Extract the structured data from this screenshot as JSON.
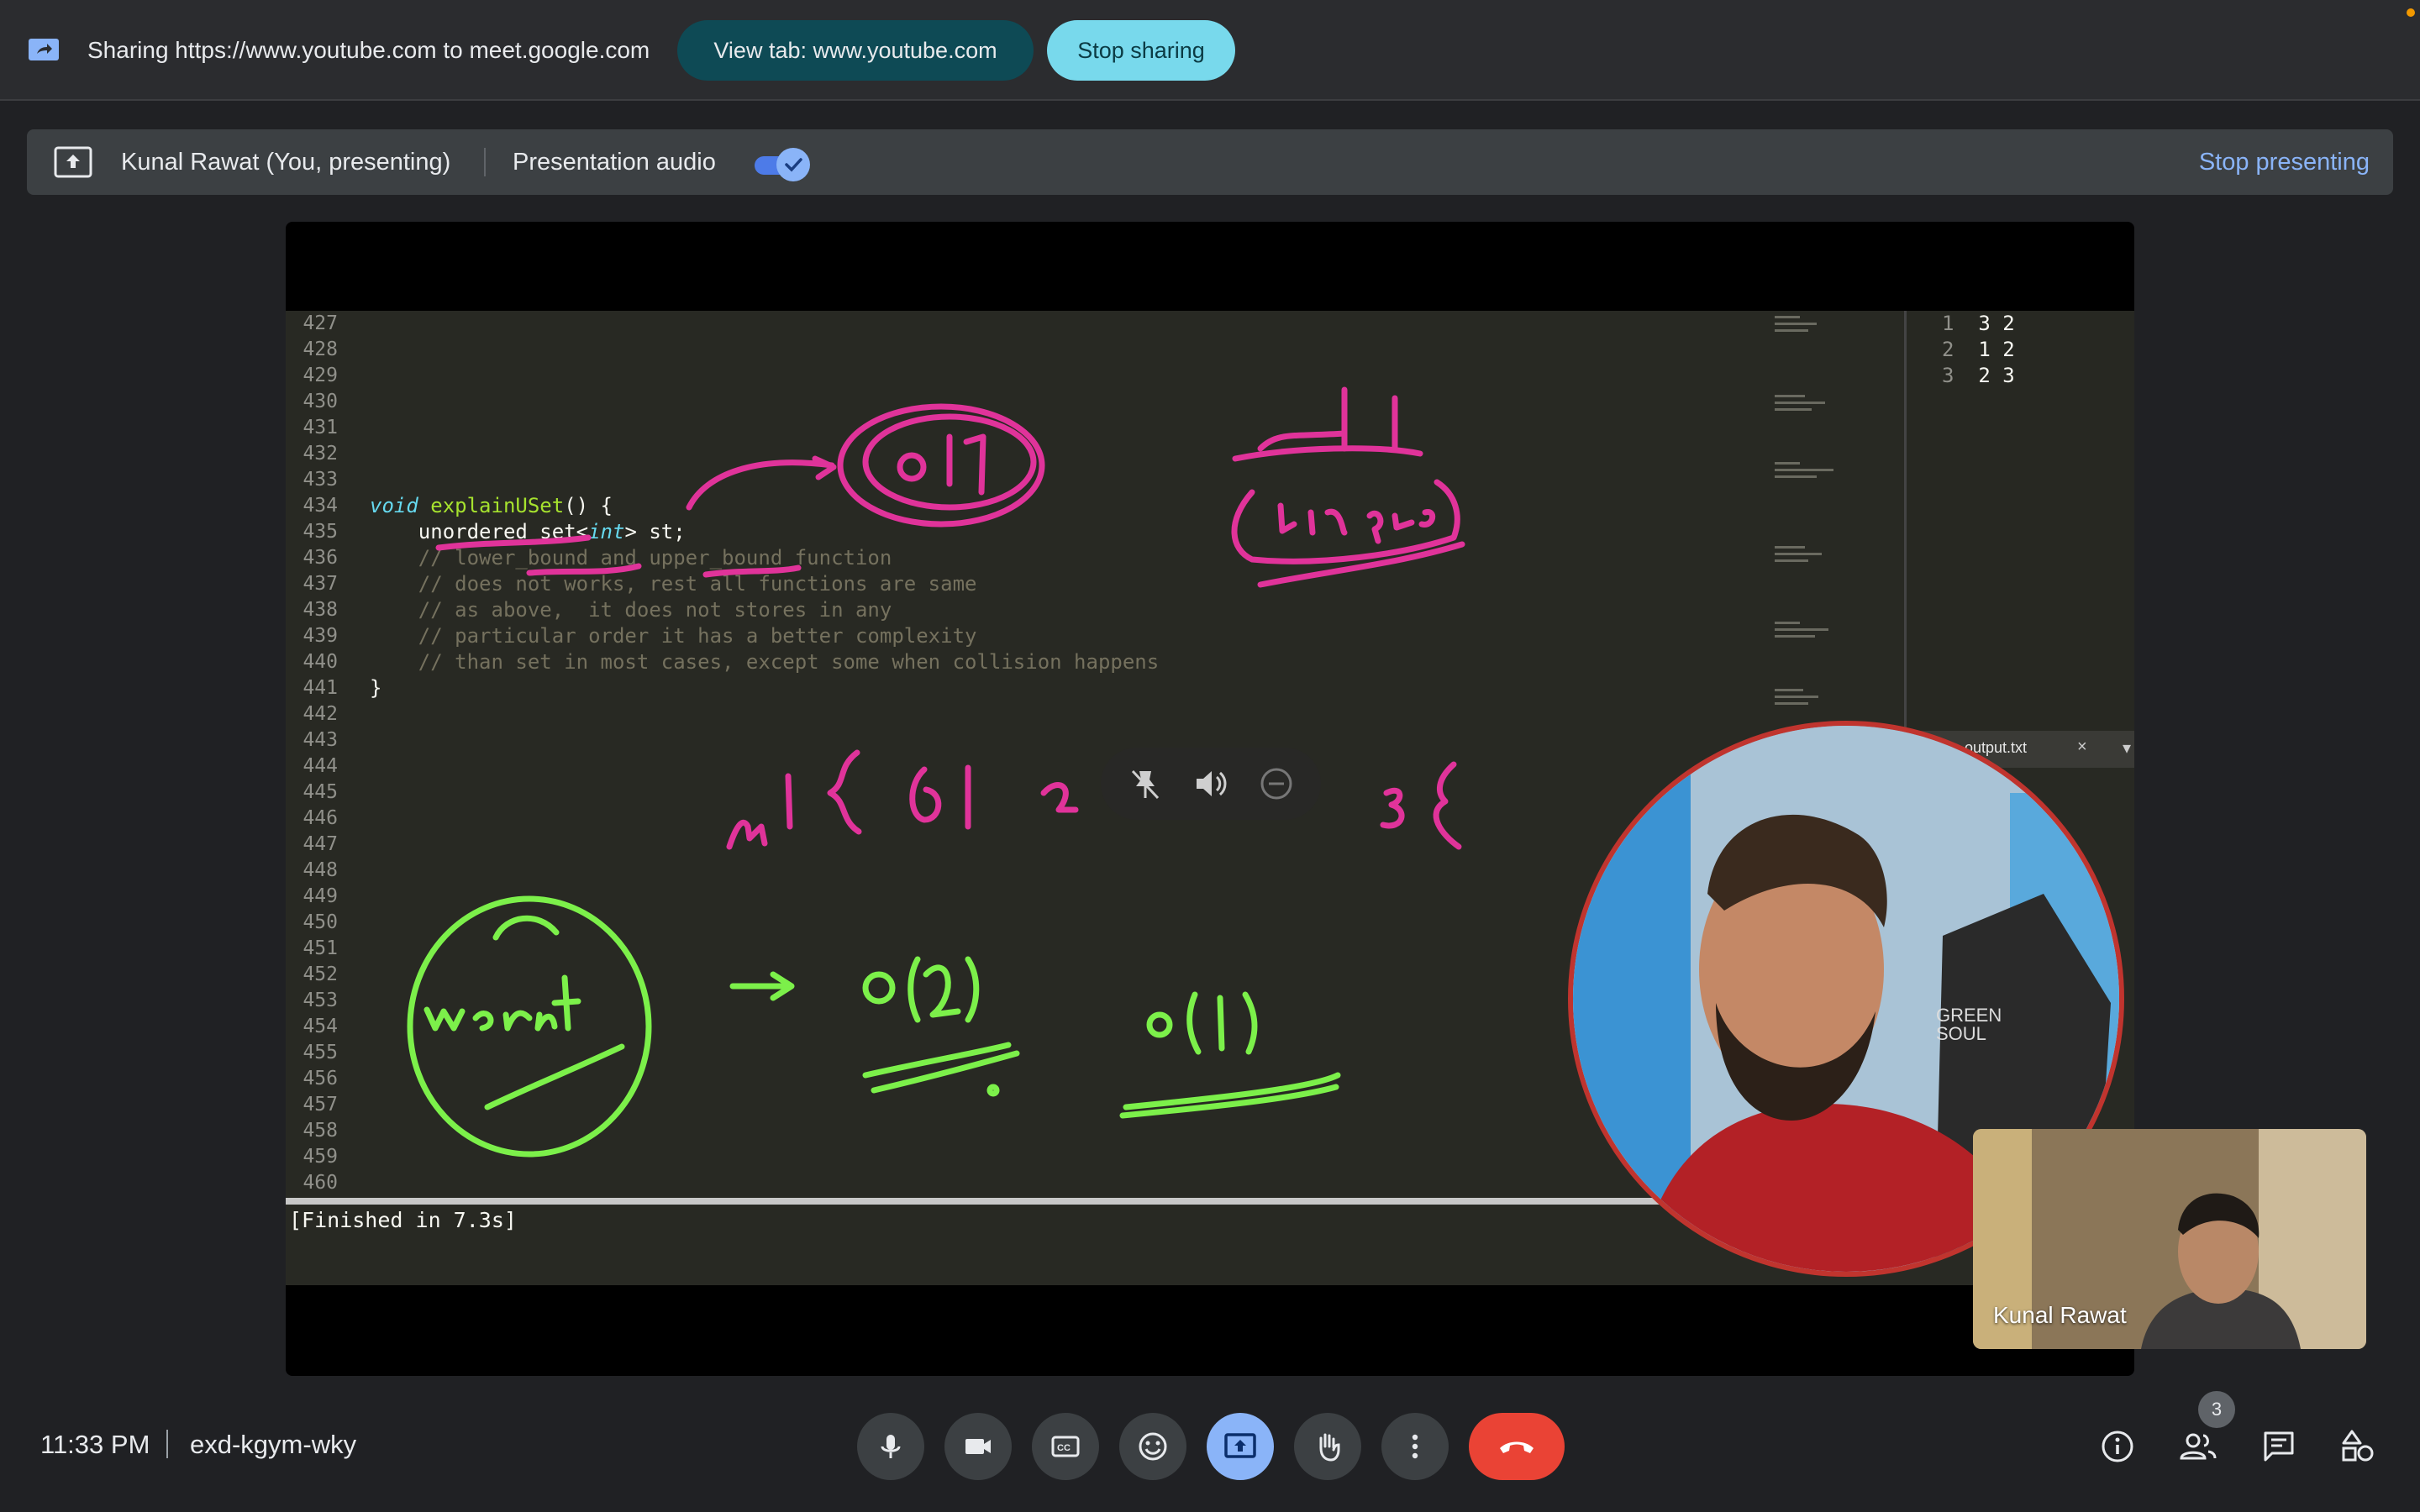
{
  "share_bar": {
    "text": "Sharing https://www.youtube.com to meet.google.com",
    "view_tab_label": "View tab: www.youtube.com",
    "stop_sharing_label": "Stop sharing"
  },
  "present_bar": {
    "presenter": "Kunal Rawat (You, presenting)",
    "audio_label": "Presentation audio",
    "audio_enabled": true,
    "stop_presenting_label": "Stop presenting"
  },
  "editor": {
    "line_numbers": [
      "427",
      "428",
      "429",
      "430",
      "431",
      "432",
      "433",
      "434",
      "435",
      "436",
      "437",
      "438",
      "439",
      "440",
      "441",
      "442",
      "443",
      "444",
      "445",
      "446",
      "447",
      "448",
      "449",
      "450",
      "451",
      "452",
      "453",
      "454",
      "455",
      "456",
      "457",
      "458",
      "459",
      "460"
    ],
    "code": {
      "l434_kw": "void",
      "l434_fn": "explainUSet",
      "l434_rest": "() {",
      "l435_a": "    unordered_set<",
      "l435_kw": "int",
      "l435_b": "> st;",
      "l436": "    // lower_bound and upper_bound function",
      "l437": "    // does not works, rest all functions are same",
      "l438": "    // as above,  it does not stores in any",
      "l439": "    // particular order it has a better complexity",
      "l440": "    // than set in most cases, except some when collision happens",
      "l441": "}"
    },
    "output_panel": {
      "rows": [
        {
          "ln": "1",
          "val": "3 2"
        },
        {
          "ln": "2",
          "val": "1 2"
        },
        {
          "ln": "3",
          "val": "2 3"
        }
      ],
      "tab_label": "output.txt",
      "close_glyph": "×",
      "arrow_glyph": "▾"
    },
    "console": "[Finished in 7.3s]"
  },
  "annotations": {
    "pink": [
      "O(1)",
      "Unique",
      "{61 2 3{"
    ],
    "green": [
      "worst",
      "O(N)",
      "O(1)"
    ]
  },
  "self_tile": {
    "name": "Kunal Rawat"
  },
  "bottom_bar": {
    "time": "11:33 PM",
    "meeting_code": "exd-kgym-wky",
    "participants_count": "3"
  },
  "icons": {
    "mic": "mic-icon",
    "camera": "camera-icon",
    "captions": "captions-icon",
    "emoji": "emoji-icon",
    "present": "present-icon",
    "hand": "raise-hand-icon",
    "more": "more-vert-icon",
    "end_call": "end-call-icon",
    "info": "info-icon",
    "people": "people-icon",
    "chat": "chat-icon",
    "activities": "activities-icon"
  },
  "colors": {
    "accent": "#8ab4f8",
    "stop_sharing": "#78d9ec",
    "view_tab": "#0e4a55",
    "end_call": "#ea4335",
    "pink_ink": "#e0339a",
    "green_ink": "#7cf04a"
  }
}
